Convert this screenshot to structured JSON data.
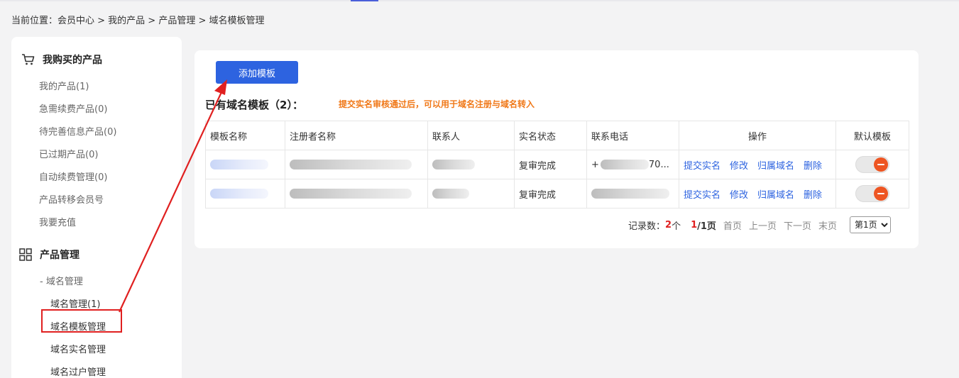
{
  "breadcrumb": {
    "prefix": "当前位置：",
    "path": "会员中心 > 我的产品 > 产品管理 > 域名模板管理"
  },
  "sidebar": {
    "section1": {
      "title": "我购买的产品",
      "icon": "cart-icon"
    },
    "items1": [
      "我的产品(1)",
      "急需续费产品(0)",
      "待完善信息产品(0)",
      "已过期产品(0)",
      "自动续费管理(0)",
      "产品转移会员号",
      "我要充值"
    ],
    "section2": {
      "title": "产品管理",
      "icon": "grid-icon"
    },
    "subhead": "- 域名管理",
    "subitems": [
      "域名管理(1)",
      "域名模板管理",
      "域名实名管理",
      "域名过户管理"
    ]
  },
  "main": {
    "add_button": "添加模板",
    "list_title": "已有域名模板（2）：",
    "notice": "提交实名审核通过后，可以用于域名注册与域名转入",
    "columns": [
      "模板名称",
      "注册者名称",
      "联系人",
      "实名状态",
      "联系电话",
      "操作",
      "默认模板"
    ],
    "rows": [
      {
        "status": "复审完成",
        "phone_prefix": "+",
        "phone_suffix": "70..."
      },
      {
        "status": "复审完成",
        "phone_prefix": "",
        "phone_suffix": ""
      }
    ],
    "actions": [
      "提交实名",
      "修改",
      "归属域名",
      "删除"
    ]
  },
  "pager": {
    "records_label": "记录数：",
    "records_count": "2",
    "records_unit": "个",
    "page_current": "1",
    "page_total": "/1页",
    "first": "首页",
    "prev": "上一页",
    "next": "下一页",
    "last": "末页",
    "select_value": "第1页"
  },
  "colors": {
    "accent": "#2d63e0",
    "notice": "#f07818",
    "highlight": "#e02020"
  }
}
